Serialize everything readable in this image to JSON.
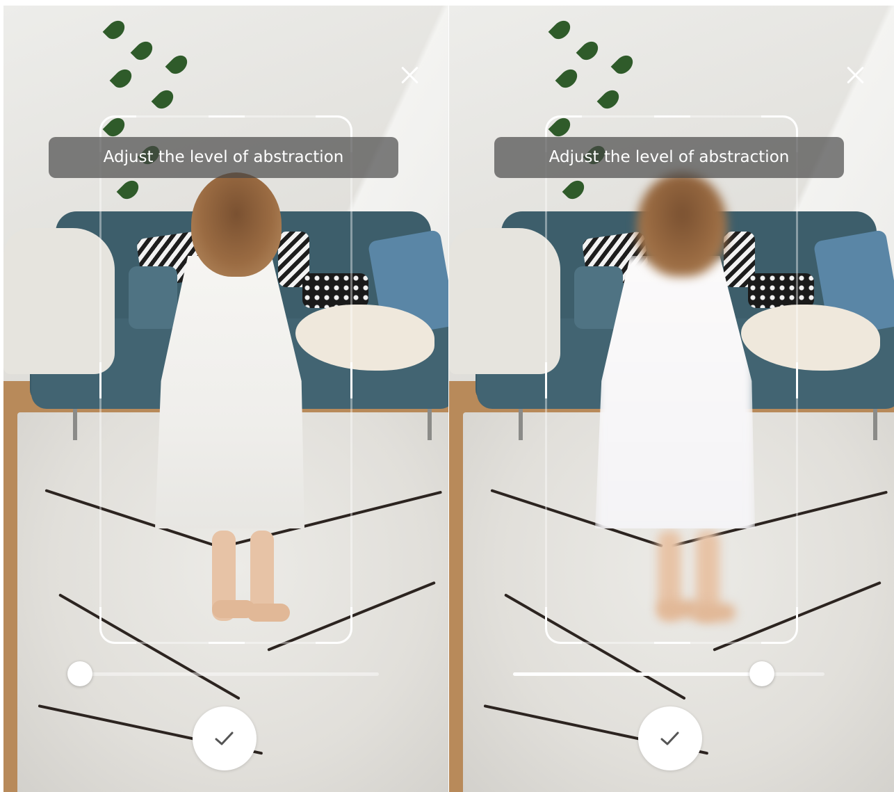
{
  "screens": [
    {
      "id": "left",
      "instruction": "Adjust the level of abstraction",
      "abstraction_level": 0.04,
      "close_icon": "close-icon",
      "confirm_icon": "checkmark-icon"
    },
    {
      "id": "right",
      "instruction": "Adjust the level of abstraction",
      "abstraction_level": 0.8,
      "close_icon": "close-icon",
      "confirm_icon": "checkmark-icon"
    }
  ],
  "colors": {
    "overlay_white": "#ffffff",
    "label_background": "rgba(70,70,70,0.68)",
    "sofa": "#426472"
  }
}
